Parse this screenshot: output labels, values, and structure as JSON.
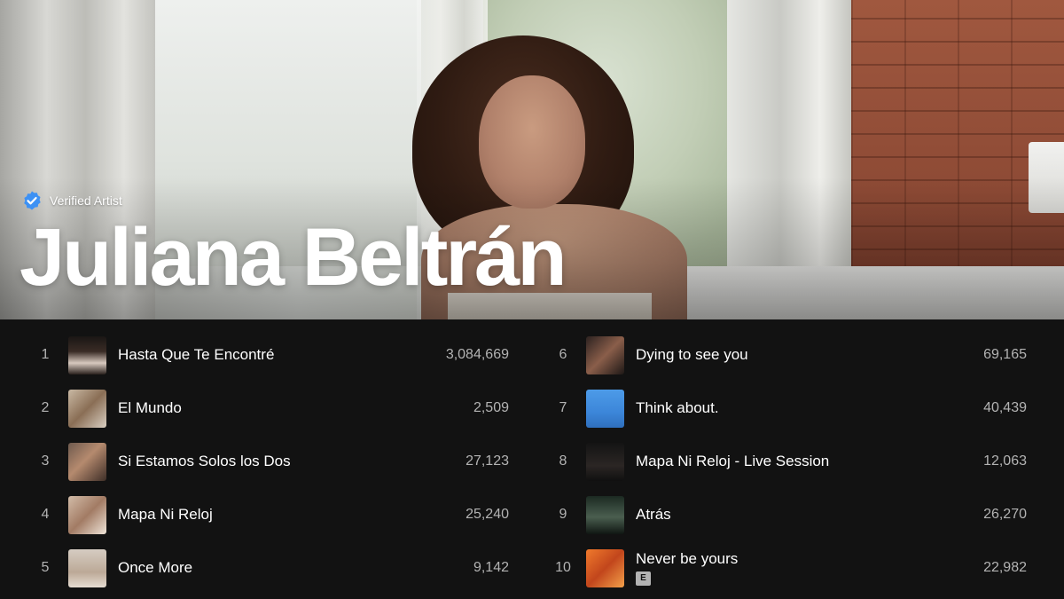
{
  "artist": {
    "verified_label": "Verified Artist",
    "name": "Juliana Beltrán"
  },
  "colors": {
    "background": "#121212",
    "verified_badge": "#3d91f4",
    "secondary_text": "#b3b3b3"
  },
  "tracks_left": [
    {
      "rank": "1",
      "title": "Hasta Que Te Encontré",
      "plays": "3,084,669",
      "explicit": false
    },
    {
      "rank": "2",
      "title": "El Mundo",
      "plays": "2,509",
      "explicit": false
    },
    {
      "rank": "3",
      "title": "Si Estamos Solos los Dos",
      "plays": "27,123",
      "explicit": false
    },
    {
      "rank": "4",
      "title": "Mapa Ni Reloj",
      "plays": "25,240",
      "explicit": false
    },
    {
      "rank": "5",
      "title": "Once More",
      "plays": "9,142",
      "explicit": false
    }
  ],
  "tracks_right": [
    {
      "rank": "6",
      "title": "Dying to see you",
      "plays": "69,165",
      "explicit": false
    },
    {
      "rank": "7",
      "title": "Think about.",
      "plays": "40,439",
      "explicit": false
    },
    {
      "rank": "8",
      "title": "Mapa Ni Reloj - Live Session",
      "plays": "12,063",
      "explicit": false
    },
    {
      "rank": "9",
      "title": "Atrás",
      "plays": "26,270",
      "explicit": false
    },
    {
      "rank": "10",
      "title": "Never be yours",
      "plays": "22,982",
      "explicit": true,
      "explicit_label": "E"
    }
  ]
}
